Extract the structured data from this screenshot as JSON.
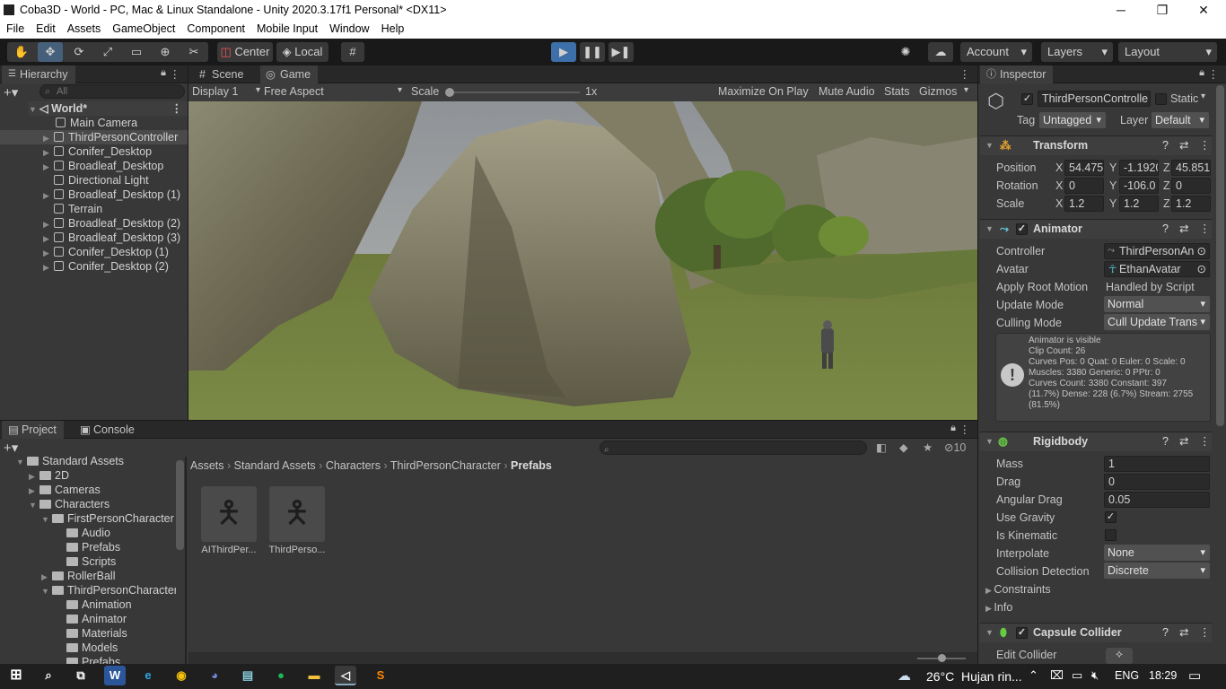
{
  "window": {
    "title": "Coba3D - World - PC, Mac & Linux Standalone - Unity 2020.3.17f1 Personal* <DX11>",
    "min": "─",
    "max": "❐",
    "close": "✕"
  },
  "menu": [
    "File",
    "Edit",
    "Assets",
    "GameObject",
    "Component",
    "Mobile Input",
    "Window",
    "Help"
  ],
  "toolbar": {
    "center": "Center",
    "local": "Local",
    "account": "Account",
    "layers": "Layers",
    "layout": "Layout"
  },
  "hierarchy": {
    "title": "Hierarchy",
    "search_placeholder": "All",
    "scene": "World*",
    "items": [
      "Main Camera",
      "ThirdPersonController",
      "Conifer_Desktop",
      "Broadleaf_Desktop",
      "Directional Light",
      "Broadleaf_Desktop (1)",
      "Terrain",
      "Broadleaf_Desktop (2)",
      "Broadleaf_Desktop (3)",
      "Conifer_Desktop (1)",
      "Conifer_Desktop (2)"
    ]
  },
  "sceneview": {
    "tab_scene": "Scene",
    "tab_game": "Game",
    "display": "Display 1",
    "aspect": "Free Aspect",
    "scale_label": "Scale",
    "scale_value": "1x",
    "maximize": "Maximize On Play",
    "mute": "Mute Audio",
    "stats": "Stats",
    "gizmos": "Gizmos"
  },
  "project": {
    "tab_project": "Project",
    "tab_console": "Console",
    "hidden_count": "10",
    "tree": [
      "Standard Assets",
      "2D",
      "Cameras",
      "Characters",
      "FirstPersonCharacter",
      "Audio",
      "Prefabs",
      "Scripts",
      "RollerBall",
      "ThirdPersonCharacter",
      "Animation",
      "Animator",
      "Materials",
      "Models",
      "Prefabs"
    ],
    "breadcrumb": [
      "Assets",
      "Standard Assets",
      "Characters",
      "ThirdPersonCharacter",
      "Prefabs"
    ],
    "assets": [
      "AIThirdPer...",
      "ThirdPerso..."
    ]
  },
  "inspector": {
    "title": "Inspector",
    "object_name": "ThirdPersonControlle",
    "static": "Static",
    "tag_label": "Tag",
    "tag": "Untagged",
    "layer_label": "Layer",
    "layer": "Default",
    "transform": {
      "title": "Transform",
      "position_label": "Position",
      "rotation_label": "Rotation",
      "scale_label": "Scale",
      "pos": [
        "54.475",
        "-1.1920",
        "45.851"
      ],
      "rot": [
        "0",
        "-106.0",
        "0"
      ],
      "scale": [
        "1.2",
        "1.2",
        "1.2"
      ]
    },
    "animator": {
      "title": "Animator",
      "controller_label": "Controller",
      "controller": "ThirdPersonAn",
      "avatar_label": "Avatar",
      "avatar": "EthanAvatar",
      "root_label": "Apply Root Motion",
      "root": "Handled by Script",
      "update_label": "Update Mode",
      "update": "Normal",
      "culling_label": "Culling Mode",
      "culling": "Cull Update Trans",
      "info": [
        "Animator is visible",
        "Clip Count: 26",
        "Curves Pos: 0 Quat: 0 Euler: 0 Scale: 0",
        "Muscles: 3380 Generic: 0 PPtr: 0",
        "Curves Count: 3380 Constant: 397",
        "(11.7%) Dense: 228 (6.7%) Stream: 2755",
        "(81.5%)"
      ]
    },
    "rigidbody": {
      "title": "Rigidbody",
      "mass_label": "Mass",
      "mass": "1",
      "drag_label": "Drag",
      "drag": "0",
      "adrag_label": "Angular Drag",
      "adrag": "0.05",
      "gravity_label": "Use Gravity",
      "kin_label": "Is Kinematic",
      "interp_label": "Interpolate",
      "interp": "None",
      "coll_label": "Collision Detection",
      "coll": "Discrete",
      "constraints": "Constraints",
      "info": "Info"
    },
    "capsule": {
      "title": "Capsule Collider",
      "edit": "Edit Collider"
    }
  },
  "taskbar": {
    "temp": "26°C",
    "weather": "Hujan rin...",
    "lang": "ENG",
    "time": "18:29"
  }
}
